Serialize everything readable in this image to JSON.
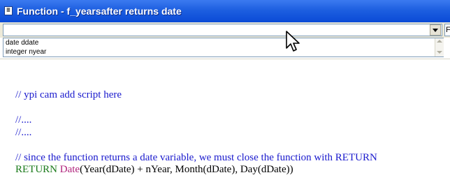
{
  "window": {
    "title": "Function - f_yearsafter returns date",
    "icon": "script-window-icon"
  },
  "toolbar": {
    "combo_value": "",
    "second_combo_value": "F"
  },
  "arguments": [
    "date ddate",
    "integer nyear"
  ],
  "script": {
    "lines": [
      {
        "text": "// ypi cam add script here"
      },
      {
        "text": "//...."
      },
      {
        "text": "//...."
      },
      {
        "text": "// since the function returns a date variable, we must close the function with RETURN"
      },
      {
        "kw": "RETURN",
        "fn": "Date",
        "rest": "(Year(dDate) + nYear, Month(dDate), Day(dDate))"
      }
    ]
  },
  "colors": {
    "comment": "#1a1acd",
    "keyword": "#1a7a1a",
    "function": "#b0237c",
    "title_bar": "#0a4ad6"
  }
}
